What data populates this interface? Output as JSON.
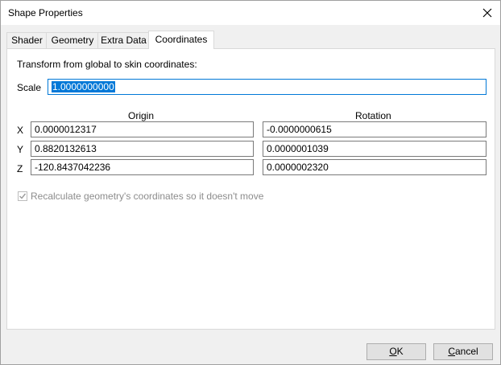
{
  "window": {
    "title": "Shape Properties"
  },
  "tabs": [
    {
      "label": "Shader"
    },
    {
      "label": "Geometry"
    },
    {
      "label": "Extra Data"
    },
    {
      "label": "Coordinates",
      "active": true
    }
  ],
  "coordinates": {
    "heading": "Transform from global to skin coordinates:",
    "scale_label": "Scale",
    "scale_value": "1.0000000000",
    "origin_header": "Origin",
    "rotation_header": "Rotation",
    "rows": [
      {
        "axis": "X",
        "origin": "0.0000012317",
        "rotation": "-0.0000000615"
      },
      {
        "axis": "Y",
        "origin": "0.8820132613",
        "rotation": "0.0000001039"
      },
      {
        "axis": "Z",
        "origin": "-120.8437042236",
        "rotation": "0.0000002320"
      }
    ],
    "recalc_label": "Recalculate geometry's coordinates so it doesn't move",
    "recalc_checked": true
  },
  "buttons": {
    "ok_mnemonic": "O",
    "ok_rest": "K",
    "cancel_mnemonic": "C",
    "cancel_rest": "ancel"
  },
  "colors": {
    "accent": "#0078d7",
    "disabled_text": "#8c8c8c"
  }
}
